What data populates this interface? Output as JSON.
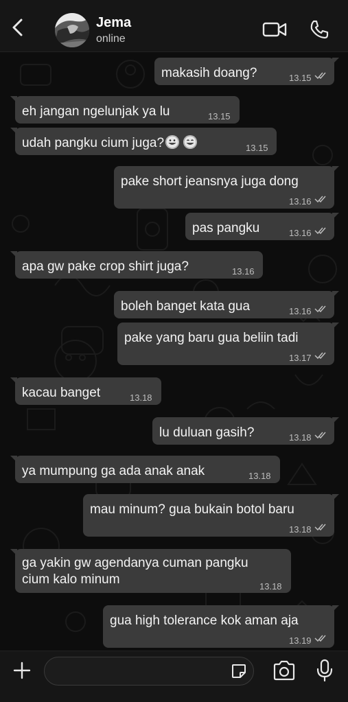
{
  "header": {
    "contact_name": "Jema",
    "status": "online"
  },
  "messages": [
    {
      "dir": "out",
      "text": "makasih doang?",
      "time": "13.15",
      "read": true
    },
    {
      "dir": "in",
      "text": "eh jangan ngelunjak ya lu",
      "time": "13.15"
    },
    {
      "dir": "in",
      "text": "udah pangku cium juga?",
      "emoji": [
        "grinning-face",
        "beaming-face"
      ],
      "time": "13.15"
    },
    {
      "dir": "out",
      "text": "pake short jeansnya juga dong",
      "time": "13.16",
      "read": true
    },
    {
      "dir": "out",
      "text": "pas pangku",
      "time": "13.16",
      "read": true
    },
    {
      "dir": "in",
      "text": "apa gw pake crop shirt juga?",
      "time": "13.16"
    },
    {
      "dir": "out",
      "text": "boleh banget kata gua",
      "time": "13.16",
      "read": true
    },
    {
      "dir": "out",
      "text": "pake yang baru gua beliin tadi",
      "time": "13.17",
      "read": true
    },
    {
      "dir": "in",
      "text": "kacau banget",
      "time": "13.18"
    },
    {
      "dir": "out",
      "text": "lu duluan gasih?",
      "time": "13.18",
      "read": true
    },
    {
      "dir": "in",
      "text": "ya mumpung ga ada anak anak",
      "time": "13.18"
    },
    {
      "dir": "out",
      "text": "mau minum? gua bukain botol baru",
      "time": "13.18",
      "read": true
    },
    {
      "dir": "in",
      "text_lines": [
        "ga yakin gw agendanya cuman pangku",
        "cium kalo minum"
      ],
      "time": "13.18"
    },
    {
      "dir": "out",
      "text": "gua high tolerance kok aman aja",
      "time": "13.19",
      "read": true
    }
  ],
  "icons": {
    "back": "chevron-left-icon",
    "video": "video-camera-icon",
    "call": "phone-icon",
    "attach": "plus-icon",
    "sticker": "sticker-icon",
    "camera": "camera-icon",
    "mic": "microphone-icon",
    "read_receipt": "double-check-icon"
  },
  "colors": {
    "background": "#0d0d0d",
    "bar": "#161616",
    "bubble": "#3b3b3b",
    "text": "#f3f3f3",
    "meta": "#bdbdbd"
  }
}
